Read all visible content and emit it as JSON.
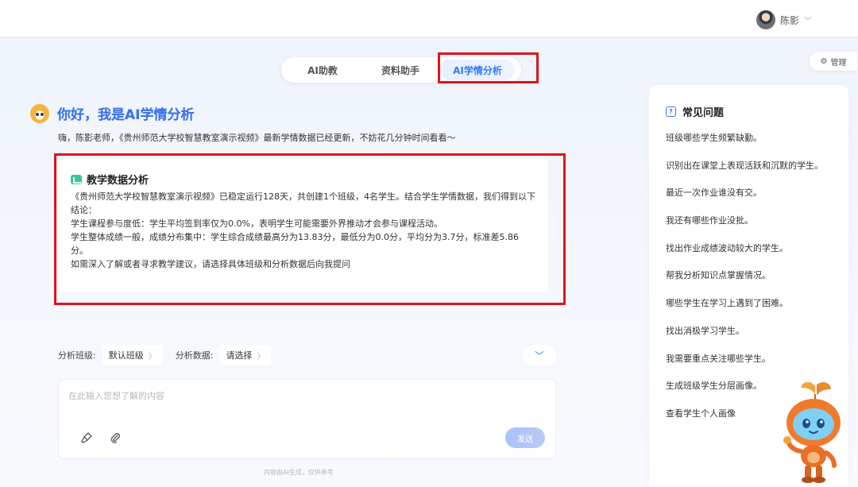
{
  "header": {
    "user_name": "陈影"
  },
  "manage": {
    "label": "管理"
  },
  "tabs": [
    {
      "label": "AI助教",
      "active": false
    },
    {
      "label": "资料助手",
      "active": false
    },
    {
      "label": "AI学情分析",
      "active": true
    }
  ],
  "greeting": {
    "title": "你好，我是AI学情分析",
    "subtitle": "嗨，陈影老师，《贵州师范大学校智慧教室演示视频》最新学情数据已经更新，不妨花几分钟时间看看～"
  },
  "analysis": {
    "title": "教学数据分析",
    "lines": [
      "《贵州师范大学校智慧教室演示视频》已稳定运行128天，共创建1个班级，4名学生。结合学生学情数据，我们得到以下结论：",
      "学生课程参与度低：学生平均签到率仅为0.0%，表明学生可能需要外界推动才会参与课程活动。",
      "学生整体成绩一般，成绩分布集中：学生综合成绩最高分为13.83分，最低分为0.0分，平均分为3.7分，标准差5.86分。",
      "如需深入了解或者寻求教学建议，请选择具体班级和分析数据后向我提问"
    ]
  },
  "filters": {
    "class_label": "分析班级:",
    "class_value": "默认班级",
    "data_label": "分析数据:",
    "data_value": "请选择"
  },
  "input": {
    "placeholder": "在此输入您想了解的内容",
    "send_label": "发送"
  },
  "footer_note": "内容由AI生成，仅供参考",
  "faq": {
    "title": "常见问题",
    "items": [
      "班级哪些学生频繁缺勤。",
      "识别出在课堂上表现活跃和沉默的学生。",
      "最近一次作业谁没有交。",
      "我还有哪些作业没批。",
      "找出作业成绩波动较大的学生。",
      "帮我分析知识点掌握情况。",
      "哪些学生在学习上遇到了困难。",
      "找出消极学习学生。",
      "我需要重点关注哪些学生。",
      "生成班级学生分层画像。",
      "查看学生个人画像"
    ]
  },
  "colors": {
    "accent": "#3a72ef",
    "highlight_border": "#e0141e",
    "analysis_icon": "#3cc59a"
  }
}
